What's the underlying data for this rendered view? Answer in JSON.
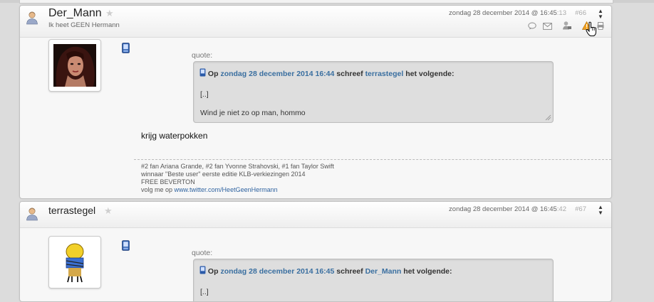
{
  "posts": [
    {
      "username": "Der_Mann",
      "user_title": "Ik heet GEEN Hermann",
      "date": "zondag 28 december 2014 @ 16:45",
      "seconds": ":13",
      "post_number": "#66",
      "quote_label": "quote:",
      "quote": {
        "prefix": "Op",
        "date_link": "zondag 28 december 2014 16:44",
        "middle": "schreef",
        "user_link": "terrastegel",
        "suffix": "het volgende:",
        "lines": [
          "[..]",
          "Wind je niet zo op man, hommo"
        ]
      },
      "body": "krijg waterpokken",
      "signature": [
        "#2 fan Ariana Grande, #2 fan Yvonne Strahovski, #1 fan Taylor Swift",
        "winnaar \"Beste user\" eerste editie KLB-verkiezingen 2014",
        "FREE BEVERTON"
      ],
      "sig_link_prefix": "volg me op",
      "sig_link": "www.twitter.com/HeetGeenHermann"
    },
    {
      "username": "terrastegel",
      "date": "zondag 28 december 2014 @ 16:45",
      "seconds": ":42",
      "post_number": "#67",
      "quote_label": "quote:",
      "quote": {
        "prefix": "Op",
        "date_link": "zondag 28 december 2014 16:45",
        "middle": "schreef",
        "user_link": "Der_Mann",
        "suffix": "het volgende:",
        "lines": [
          "[..]"
        ]
      }
    }
  ],
  "icons": {
    "user": "user-icon",
    "star": "star-icon",
    "reply": "reply-icon",
    "message": "envelope-icon",
    "profile": "user-profile-icon",
    "report": "warning-icon",
    "device": "mobile-device-icon"
  },
  "colors": {
    "link": "#3a6fa0",
    "accent": "#f0a020"
  }
}
